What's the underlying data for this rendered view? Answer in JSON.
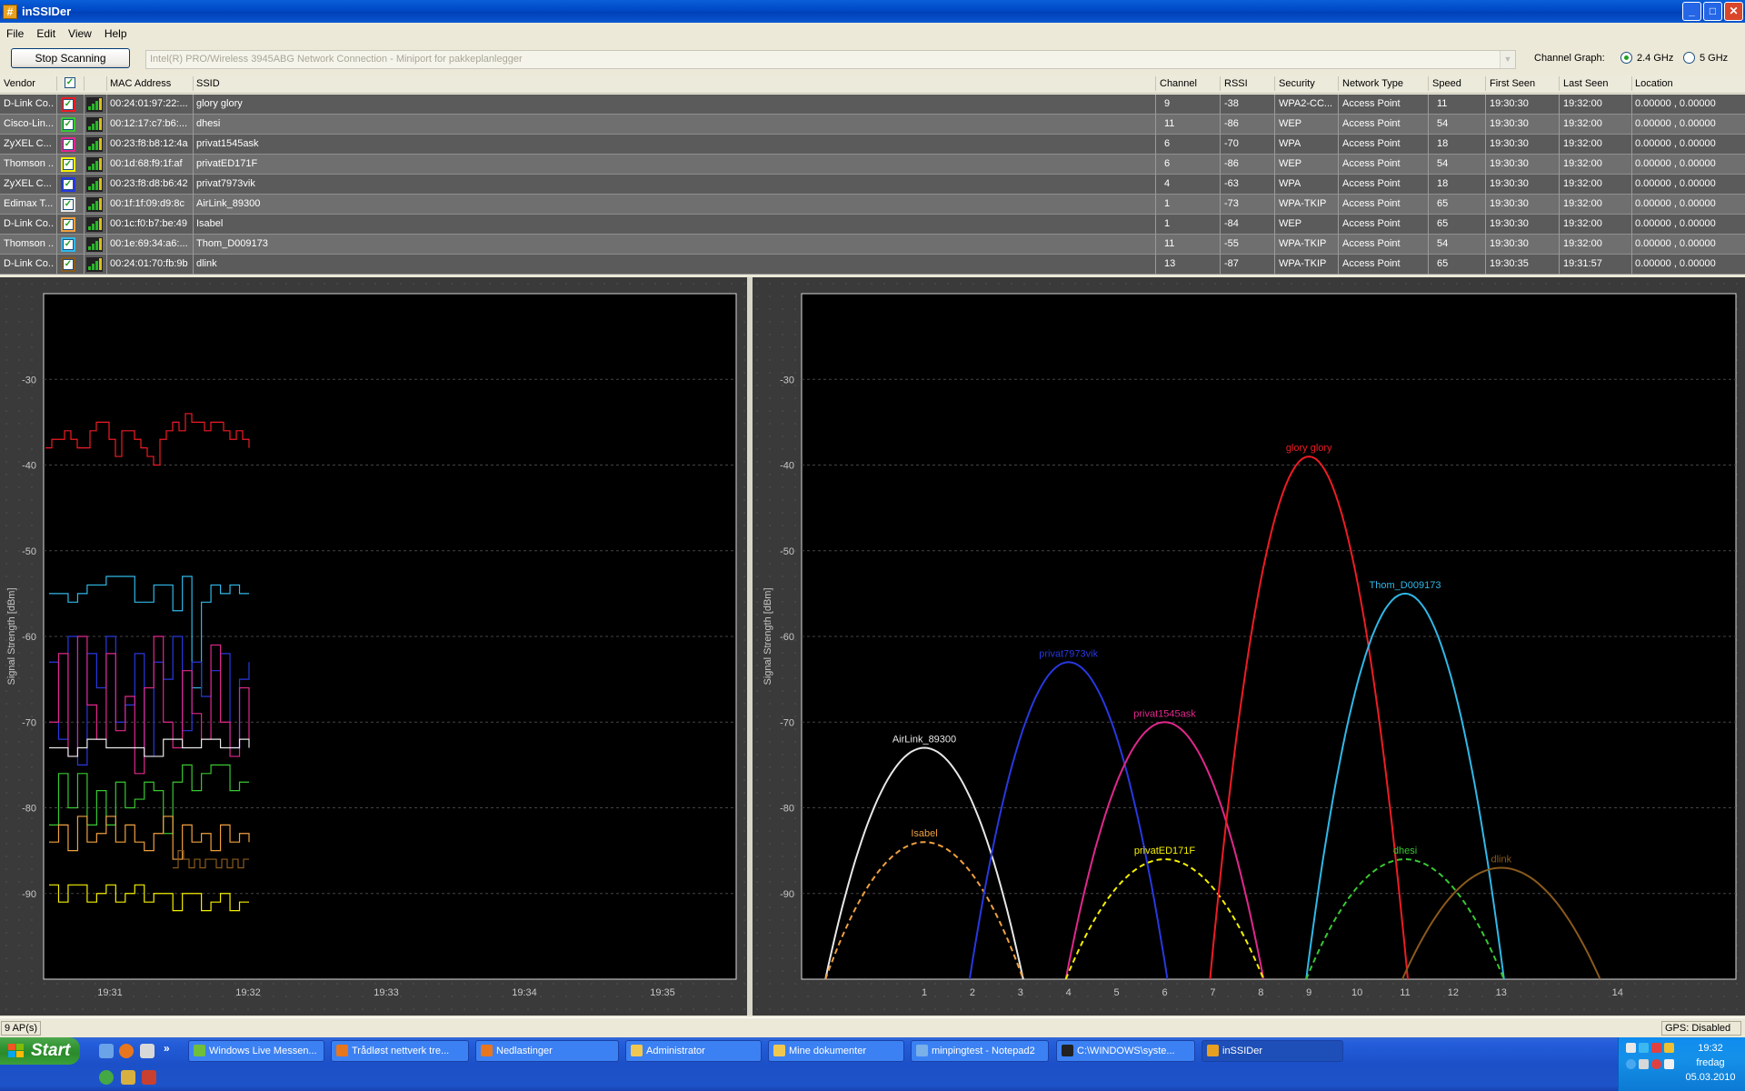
{
  "window": {
    "title": "inSSIDer",
    "buttons": [
      "_",
      "□",
      "✕"
    ]
  },
  "menu": [
    "File",
    "Edit",
    "View",
    "Help"
  ],
  "toolbar": {
    "stop_label": "Stop Scanning",
    "adapter": "Intel(R) PRO/Wireless 3945ABG Network Connection - Miniport for pakkeplanlegger",
    "channel_graph_label": "Channel Graph:",
    "band_24": "2.4 GHz",
    "band_5": "5 GHz",
    "band_selected": "2.4 GHz"
  },
  "table": {
    "columns": [
      "Vendor",
      "",
      "",
      "MAC Address",
      "SSID",
      "Channel",
      "RSSI",
      "Security",
      "Network Type",
      "Speed",
      "First Seen",
      "Last Seen",
      "Location"
    ],
    "rows": [
      {
        "vendor": "D-Link Co...",
        "color": "#ee1c24",
        "mac": "00:24:01:97:22:...",
        "ssid": "glory glory",
        "channel": "9",
        "rssi": "-38",
        "security": "WPA2-CC...",
        "type": "Access Point",
        "speed": "11",
        "first": "19:30:30",
        "last": "19:32:00",
        "location": "0.00000 , 0.00000"
      },
      {
        "vendor": "Cisco-Lin...",
        "color": "#38c832",
        "mac": "00:12:17:c7:b6:...",
        "ssid": "dhesi",
        "channel": "11",
        "rssi": "-86",
        "security": "WEP",
        "type": "Access Point",
        "speed": "54",
        "first": "19:30:30",
        "last": "19:32:00",
        "location": "0.00000 , 0.00000"
      },
      {
        "vendor": "ZyXEL C...",
        "color": "#e0288c",
        "mac": "00:23:f8:b8:12:4a",
        "ssid": "privat1545ask",
        "channel": "6",
        "rssi": "-70",
        "security": "WPA",
        "type": "Access Point",
        "speed": "18",
        "first": "19:30:30",
        "last": "19:32:00",
        "location": "0.00000 , 0.00000"
      },
      {
        "vendor": "Thomson ...",
        "color": "#f5f000",
        "mac": "00:1d:68:f9:1f:af",
        "ssid": "privatED171F",
        "channel": "6",
        "rssi": "-86",
        "security": "WEP",
        "type": "Access Point",
        "speed": "54",
        "first": "19:30:30",
        "last": "19:32:00",
        "location": "0.00000 , 0.00000"
      },
      {
        "vendor": "ZyXEL C...",
        "color": "#2838e0",
        "mac": "00:23:f8:d8:b6:42",
        "ssid": "privat7973vik",
        "channel": "4",
        "rssi": "-63",
        "security": "WPA",
        "type": "Access Point",
        "speed": "18",
        "first": "19:30:30",
        "last": "19:32:00",
        "location": "0.00000 , 0.00000"
      },
      {
        "vendor": "Edimax T...",
        "color": "#e8e8e8",
        "mac": "00:1f:1f:09:d9:8c",
        "ssid": "AirLink_89300",
        "channel": "1",
        "rssi": "-73",
        "security": "WPA-TKIP",
        "type": "Access Point",
        "speed": "65",
        "first": "19:30:30",
        "last": "19:32:00",
        "location": "0.00000 , 0.00000"
      },
      {
        "vendor": "D-Link Co...",
        "color": "#f0a040",
        "mac": "00:1c:f0:b7:be:49",
        "ssid": "Isabel",
        "channel": "1",
        "rssi": "-84",
        "security": "WEP",
        "type": "Access Point",
        "speed": "65",
        "first": "19:30:30",
        "last": "19:32:00",
        "location": "0.00000 , 0.00000"
      },
      {
        "vendor": "Thomson ...",
        "color": "#30b8e8",
        "mac": "00:1e:69:34:a6:...",
        "ssid": "Thom_D009173",
        "channel": "11",
        "rssi": "-55",
        "security": "WPA-TKIP",
        "type": "Access Point",
        "speed": "54",
        "first": "19:30:30",
        "last": "19:32:00",
        "location": "0.00000 , 0.00000"
      },
      {
        "vendor": "D-Link Co...",
        "color": "#8a5a1c",
        "mac": "00:24:01:70:fb:9b",
        "ssid": "dlink",
        "channel": "13",
        "rssi": "-87",
        "security": "WPA-TKIP",
        "type": "Access Point",
        "speed": "65",
        "first": "19:30:35",
        "last": "19:31:57",
        "location": "0.00000 , 0.00000"
      }
    ]
  },
  "chart_data": [
    {
      "type": "line",
      "ylabel": "Signal Strength [dBm]",
      "ylim": [
        -100,
        -20
      ],
      "y_ticks": [
        "-30",
        "-40",
        "-50",
        "-60",
        "-70",
        "-80",
        "-90"
      ],
      "x_ticks": [
        "19:31",
        "19:32",
        "19:33",
        "19:34",
        "19:35"
      ],
      "series": [
        {
          "ssid": "glory glory",
          "color": "#ee1c24",
          "values": [
            -38,
            -37,
            -37,
            -36,
            -37,
            -38,
            -38,
            -36,
            -35,
            -35,
            -37,
            -39,
            -36,
            -36,
            -37,
            -38,
            -39,
            -40,
            -37,
            -36,
            -35,
            -36,
            -34,
            -35,
            -35,
            -36,
            -35,
            -35,
            -36,
            -37,
            -36,
            -37,
            -38
          ]
        },
        {
          "ssid": "Thom_D009173",
          "color": "#30b8e8",
          "values": [
            -55,
            -55,
            -56,
            -55,
            -54,
            -54,
            -53,
            -53,
            -53,
            -56,
            -56,
            -54,
            -54,
            -57,
            -53,
            -66,
            -56,
            -54,
            -55,
            -54,
            -55,
            -55
          ]
        },
        {
          "ssid": "privat7973vik",
          "color": "#2838e0",
          "values": [
            -63,
            -72,
            -60,
            -75,
            -62,
            -66,
            -60,
            -70,
            -68,
            -62,
            -74,
            -63,
            -65,
            -60,
            -71,
            -63,
            -67,
            -64,
            -62,
            -73,
            -65,
            -63
          ]
        },
        {
          "ssid": "privat1545ask",
          "color": "#e0288c",
          "values": [
            -70,
            -62,
            -74,
            -60,
            -68,
            -72,
            -62,
            -71,
            -67,
            -76,
            -66,
            -60,
            -70,
            -73,
            -64,
            -69,
            -72,
            -61,
            -70,
            -74,
            -66,
            -72
          ]
        },
        {
          "ssid": "AirLink_89300",
          "color": "#e8e8e8",
          "values": [
            -73,
            -73,
            -74,
            -73,
            -72,
            -72,
            -73,
            -73,
            -73,
            -73,
            -74,
            -74,
            -72,
            -72,
            -73,
            -73,
            -72,
            -72,
            -73,
            -73,
            -72,
            -73
          ]
        },
        {
          "ssid": "dhesi",
          "color": "#38c832",
          "values": [
            -82,
            -76,
            -80,
            -76,
            -82,
            -78,
            -82,
            -77,
            -80,
            -79,
            -77,
            -78,
            -83,
            -77,
            -75,
            -78,
            -76,
            -75,
            -75,
            -78,
            -77,
            -77
          ]
        },
        {
          "ssid": "Isabel",
          "color": "#f0a040",
          "values": [
            -84,
            -82,
            -85,
            -81,
            -84,
            -83,
            -81,
            -84,
            -82,
            -84,
            -85,
            -83,
            -81,
            -86,
            -82,
            -84,
            -83,
            -85,
            -82,
            -84,
            -83,
            -84
          ]
        },
        {
          "ssid": "privatED171F",
          "color": "#f5f000",
          "values": [
            -89,
            -91,
            -89,
            -89,
            -91,
            -90,
            -89,
            -91,
            -90,
            -89,
            -91,
            -90,
            -90,
            -92,
            -90,
            -90,
            -92,
            -91,
            -90,
            -92,
            -91,
            -91
          ]
        },
        {
          "ssid": "dlink",
          "color": "#8a5a1c",
          "values": [
            -87,
            -85,
            -86,
            -87,
            -86,
            -87,
            -86,
            -86,
            -87,
            -86,
            -87,
            -86,
            -87,
            -86,
            -86
          ]
        }
      ]
    },
    {
      "type": "area",
      "ylabel": "Signal Strength [dBm]",
      "ylim": [
        -100,
        -20
      ],
      "y_ticks": [
        "-30",
        "-40",
        "-50",
        "-60",
        "-70",
        "-80",
        "-90"
      ],
      "x_ticks": [
        "1",
        "2",
        "3",
        "4",
        "5",
        "6",
        "7",
        "8",
        "9",
        "10",
        "11",
        "12",
        "13",
        "14"
      ],
      "series": [
        {
          "ssid": "AirLink_89300",
          "channel": 1,
          "rssi": -73,
          "color": "#e8e8e8",
          "dashed": false
        },
        {
          "ssid": "Isabel",
          "channel": 1,
          "rssi": -84,
          "color": "#f0a040",
          "dashed": true
        },
        {
          "ssid": "privat7973vik",
          "channel": 4,
          "rssi": -63,
          "color": "#2838e0",
          "dashed": false
        },
        {
          "ssid": "privat1545ask",
          "channel": 6,
          "rssi": -70,
          "color": "#e0288c",
          "dashed": false
        },
        {
          "ssid": "privatED171F",
          "channel": 6,
          "rssi": -86,
          "color": "#f5f000",
          "dashed": true
        },
        {
          "ssid": "glory glory",
          "channel": 9,
          "rssi": -39,
          "color": "#ee1c24",
          "dashed": false
        },
        {
          "ssid": "Thom_D009173",
          "channel": 11,
          "rssi": -55,
          "color": "#30b8e8",
          "dashed": false
        },
        {
          "ssid": "dhesi",
          "channel": 11,
          "rssi": -86,
          "color": "#38c832",
          "dashed": true
        },
        {
          "ssid": "dlink",
          "channel": 13,
          "rssi": -87,
          "color": "#8a5a1c",
          "dashed": false
        }
      ]
    }
  ],
  "status": {
    "ap_count": "9 AP(s)",
    "gps": "GPS: Disabled"
  },
  "taskbar": {
    "start_label": "Start",
    "tasks": [
      {
        "label": "Windows Live Messen...",
        "icon_color": "#6fbf3a"
      },
      {
        "label": "Trådløst nettverk tre...",
        "icon_color": "#e8761c"
      },
      {
        "label": "Nedlastinger",
        "icon_color": "#e8761c"
      },
      {
        "label": "Administrator",
        "icon_color": "#f0c850"
      },
      {
        "label": "Mine dokumenter",
        "icon_color": "#f0c850"
      },
      {
        "label": "minpingtest - Notepad2",
        "icon_color": "#7ab0e8"
      },
      {
        "label": "C:\\WINDOWS\\syste...",
        "icon_color": "#222222"
      },
      {
        "label": "inSSIDer",
        "icon_color": "#e8a020"
      }
    ],
    "clock_time": "19:32",
    "clock_day": "fredag",
    "clock_date": "05.03.2010"
  }
}
